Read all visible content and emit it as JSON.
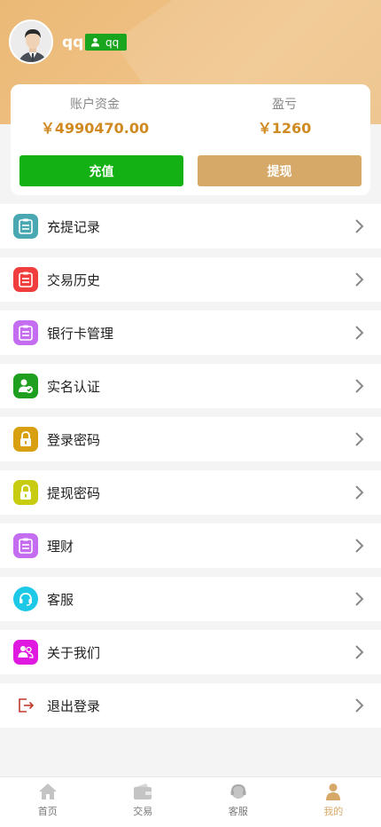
{
  "user": {
    "name": "qq",
    "badge": "qq"
  },
  "account": {
    "balance_label": "账户资金",
    "balance_value": "￥4990470.00",
    "profit_label": "盈亏",
    "profit_value": "￥1260",
    "recharge_button": "充值",
    "withdraw_button": "提现"
  },
  "menu": [
    {
      "label": "充提记录",
      "icon": "clipboard-icon",
      "color": "#4aa8b3"
    },
    {
      "label": "交易历史",
      "icon": "clipboard-icon",
      "color": "#f03e3e"
    },
    {
      "label": "银行卡管理",
      "icon": "clipboard-icon",
      "color": "#c46df0"
    },
    {
      "label": "实名认证",
      "icon": "verified-user-icon",
      "color": "#1f9f1f"
    },
    {
      "label": "登录密码",
      "icon": "lock-icon",
      "color": "#d8a010"
    },
    {
      "label": "提现密码",
      "icon": "lock-icon",
      "color": "#c8cc10"
    },
    {
      "label": "理财",
      "icon": "clipboard-icon",
      "color": "#c46df0"
    },
    {
      "label": "客服",
      "icon": "headset-icon",
      "color": "#1ec9e8"
    },
    {
      "label": "关于我们",
      "icon": "users-icon",
      "color": "#e019e0"
    },
    {
      "label": "退出登录",
      "icon": "logout-icon",
      "color": "#c0392b"
    }
  ],
  "tabbar": [
    {
      "label": "首页",
      "icon": "home-icon"
    },
    {
      "label": "交易",
      "icon": "wallet-icon"
    },
    {
      "label": "客服",
      "icon": "headset-icon"
    },
    {
      "label": "我的",
      "icon": "person-icon",
      "active": true
    }
  ],
  "colors": {
    "accent": "#d7a969",
    "green": "#13b113",
    "profit": "#d08a21"
  }
}
